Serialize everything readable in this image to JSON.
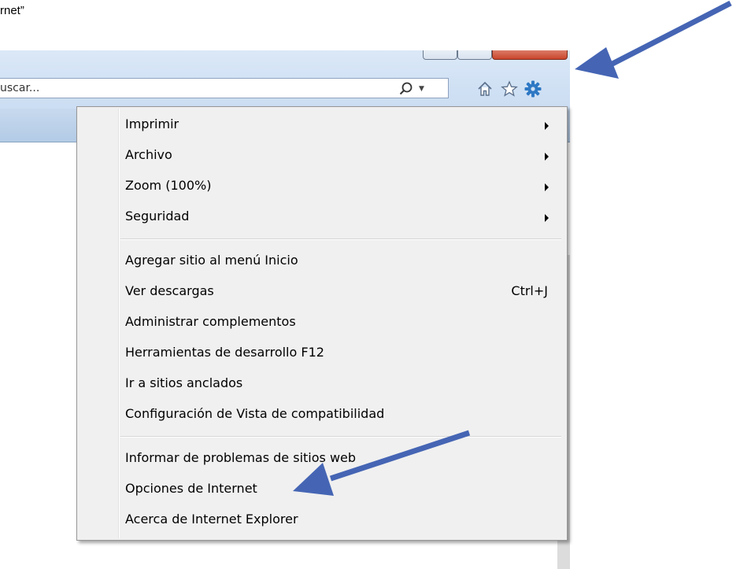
{
  "caption": "rnet”",
  "toolbar": {
    "search_text": "uscar...",
    "search_icon": "search-icon",
    "icons": [
      "home-icon",
      "favorites-star-icon",
      "tools-gear-icon"
    ]
  },
  "menu": {
    "groups": [
      [
        {
          "label": "Imprimir",
          "submenu": true
        },
        {
          "label": "Archivo",
          "submenu": true
        },
        {
          "label": "Zoom (100%)",
          "submenu": true
        },
        {
          "label": "Seguridad",
          "submenu": true
        }
      ],
      [
        {
          "label": "Agregar sitio al menú Inicio"
        },
        {
          "label": "Ver descargas",
          "shortcut": "Ctrl+J"
        },
        {
          "label": "Administrar complementos"
        },
        {
          "label": "Herramientas de desarrollo F12"
        },
        {
          "label": "Ir a sitios anclados"
        },
        {
          "label": "Configuración de Vista de compatibilidad"
        }
      ],
      [
        {
          "label": "Informar de problemas de sitios web"
        },
        {
          "label": "Opciones de Internet"
        },
        {
          "label": "Acerca de Internet Explorer"
        }
      ]
    ]
  },
  "colors": {
    "annotation_arrow": "#4565b4",
    "gear": "#2e78c4",
    "chrome": "#cfe0f4"
  }
}
